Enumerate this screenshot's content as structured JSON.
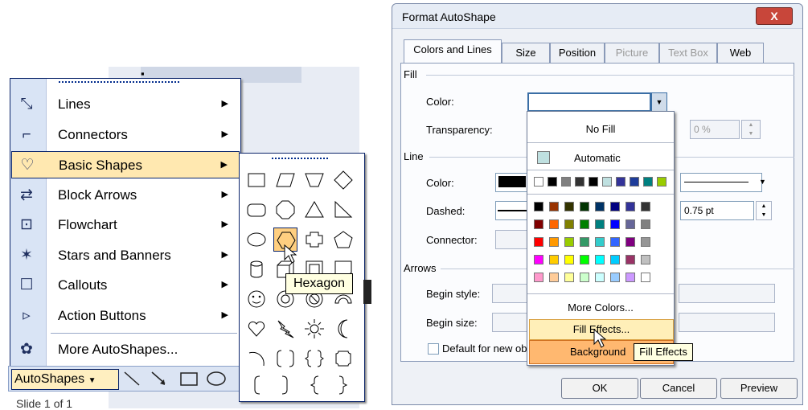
{
  "autoshapes_menu": {
    "items": [
      {
        "label": "Lines",
        "icon": "lines-icon"
      },
      {
        "label": "Connectors",
        "icon": "connectors-icon"
      },
      {
        "label": "Basic Shapes",
        "icon": "basic-shapes-icon"
      },
      {
        "label": "Block Arrows",
        "icon": "block-arrows-icon"
      },
      {
        "label": "Flowchart",
        "icon": "flowchart-icon"
      },
      {
        "label": "Stars and Banners",
        "icon": "stars-icon"
      },
      {
        "label": "Callouts",
        "icon": "callouts-icon"
      },
      {
        "label": "Action Buttons",
        "icon": "action-buttons-icon"
      }
    ],
    "more": "More AutoShapes...",
    "highlighted": "Basic Shapes"
  },
  "drawing_toolbar": {
    "autoshapes_label": "AutoShapes"
  },
  "status_text": "Slide 1 of 1",
  "shapes_palette": {
    "tooltip": "Hexagon"
  },
  "dialog": {
    "title": "Format AutoShape",
    "close_label": "X",
    "tabs": [
      "Colors and Lines",
      "Size",
      "Position",
      "Picture",
      "Text Box",
      "Web"
    ],
    "fill": {
      "section": "Fill",
      "color_label": "Color:",
      "transparency_label": "Transparency:",
      "transparency_value": "0 %"
    },
    "line": {
      "section": "Line",
      "color_label": "Color:",
      "dashed_label": "Dashed:",
      "connector_label": "Connector:",
      "weight_value": "0.75 pt"
    },
    "arrows": {
      "section": "Arrows",
      "begin_style_label": "Begin style:",
      "begin_size_label": "Begin size:"
    },
    "default_checkbox": "Default for new ob",
    "buttons": {
      "ok": "OK",
      "cancel": "Cancel",
      "preview": "Preview"
    }
  },
  "color_popup": {
    "no_fill": "No Fill",
    "automatic": "Automatic",
    "more_colors": "More Colors...",
    "fill_effects": "Fill Effects...",
    "background": "Background",
    "tooltip": "Fill Effects",
    "colors": {
      "automatic": "#bfe0e0",
      "row1": [
        "#ffffff",
        "#000000",
        "#808080",
        "#333333",
        "#000000",
        "#bfe0e0",
        "#333399",
        "#1e3c9a",
        "#008080",
        "#99cc00"
      ],
      "grid": [
        [
          "#000000",
          "#993300",
          "#333300",
          "#003300",
          "#003366",
          "#000080",
          "#333399",
          "#333333"
        ],
        [
          "#800000",
          "#ff6600",
          "#808000",
          "#008000",
          "#008080",
          "#0000ff",
          "#666699",
          "#808080"
        ],
        [
          "#ff0000",
          "#ff9900",
          "#99cc00",
          "#339966",
          "#33cccc",
          "#3366ff",
          "#800080",
          "#969696"
        ],
        [
          "#ff00ff",
          "#ffcc00",
          "#ffff00",
          "#00ff00",
          "#00ffff",
          "#00ccff",
          "#993366",
          "#c0c0c0"
        ],
        [
          "#ff99cc",
          "#ffcc99",
          "#ffff99",
          "#ccffcc",
          "#ccffff",
          "#99ccff",
          "#cc99ff",
          "#ffffff"
        ]
      ]
    }
  }
}
